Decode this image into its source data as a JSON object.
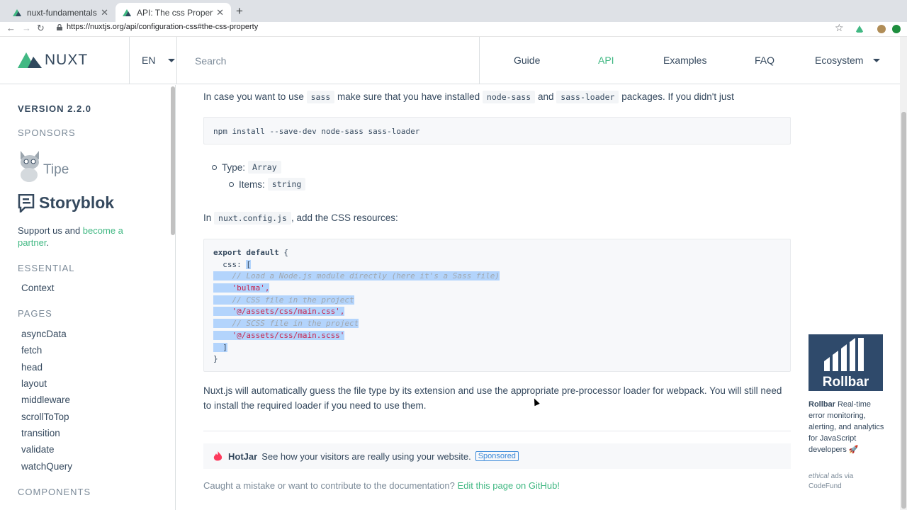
{
  "browser": {
    "tabs": [
      {
        "title": "nuxt-fundamentals",
        "active": false
      },
      {
        "title": "API: The css Property - Nuxt.js",
        "active": true
      }
    ],
    "new_tab": "+",
    "url": "https://nuxtjs.org/api/configuration-css#the-css-property"
  },
  "header": {
    "logo_text": "NUXT",
    "language": "EN",
    "search_placeholder": "Search",
    "nav": [
      "Guide",
      "API",
      "Examples",
      "FAQ",
      "Ecosystem"
    ],
    "active_nav": "API"
  },
  "sidebar": {
    "version": "VERSION 2.2.0",
    "sponsors_heading": "SPONSORS",
    "sponsors": [
      "Tipe",
      "Storyblok"
    ],
    "support_text": "Support us and ",
    "support_link": "become a partner",
    "support_end": ".",
    "essential_heading": "ESSENTIAL",
    "essential_items": [
      "Context"
    ],
    "pages_heading": "PAGES",
    "pages_items": [
      "asyncData",
      "fetch",
      "head",
      "layout",
      "middleware",
      "scrollToTop",
      "transition",
      "validate",
      "watchQuery"
    ],
    "components_heading": "COMPONENTS"
  },
  "content": {
    "p1_a": "In case you want to use ",
    "p1_code1": "sass",
    "p1_b": " make sure that you have installed ",
    "p1_code2": "node-sass",
    "p1_c": " and ",
    "p1_code3": "sass-loader",
    "p1_d": " packages. If you didn't just",
    "install_cmd": "npm install --save-dev node-sass sass-loader",
    "type_label": "Type:",
    "type_value": "Array",
    "items_label": "Items:",
    "items_value": "string",
    "p2_a": "In ",
    "p2_code": "nuxt.config.js",
    "p2_b": ", add the CSS resources:",
    "code": {
      "l1_kw": "export default",
      "l1_rest": " {",
      "l2": "  css: ",
      "l2_sel": "[",
      "l3": "    // Load a Node.js module directly (here it's a Sass file)",
      "l4": "    'bulma',",
      "l5": "    // CSS file in the project",
      "l6": "    '@/assets/css/main.css',",
      "l7": "    // SCSS file in the project",
      "l8": "    '@/assets/css/main.scss'",
      "l9": "  ]",
      "l10": "}"
    },
    "p3": "Nuxt.js will automatically guess the file type by its extension and use the appropriate pre-processor loader for webpack. You will still need to install the required loader if you need to use them.",
    "hotjar_name": "HotJar",
    "hotjar_text": "See how your visitors are really using your website.",
    "hotjar_badge": "Sponsored",
    "edit_text": "Caught a mistake or want to contribute to the documentation? ",
    "edit_link": "Edit this page on GitHub!"
  },
  "ad": {
    "brand": "Rollbar",
    "text": " Real-time error monitoring, alerting, and analytics for JavaScript developers 🚀",
    "via_italic": "ethical",
    "via_rest": " ads via CodeFund"
  },
  "colors": {
    "accent": "#41b883",
    "text": "#35495e",
    "ad_bg": "#2f4a6b"
  }
}
